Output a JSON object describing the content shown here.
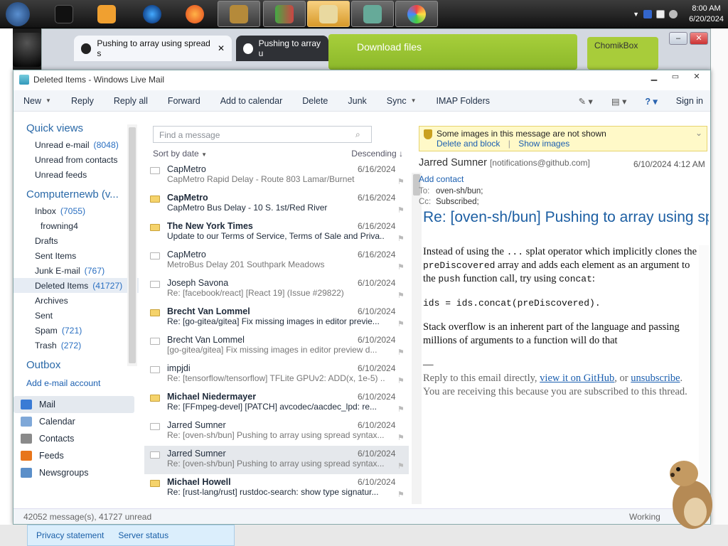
{
  "taskbar": {
    "time": "8:00 AM",
    "date": "6/20/2024"
  },
  "browser": {
    "tab1_title": "Pushing to array using spread s",
    "tab1_close": "✕",
    "tab2_title": "Pushing to array u",
    "banner_text": "Download files",
    "chomik_label": "ChomikBox"
  },
  "window": {
    "title": "Deleted Items - Windows Live Mail"
  },
  "toolbar": {
    "new": "New",
    "reply": "Reply",
    "reply_all": "Reply all",
    "forward": "Forward",
    "add_calendar": "Add to calendar",
    "delete": "Delete",
    "junk": "Junk",
    "sync": "Sync",
    "imap": "IMAP Folders",
    "sign_in": "Sign in"
  },
  "nav": {
    "quick_views": "Quick views",
    "quick": [
      {
        "label": "Unread e-mail",
        "count": "(8048)"
      },
      {
        "label": "Unread from contacts",
        "count": ""
      },
      {
        "label": "Unread feeds",
        "count": ""
      }
    ],
    "account": "Computernewb (v...",
    "folders": [
      {
        "label": "Inbox",
        "count": "(7055)"
      },
      {
        "label": "frowning4",
        "count": ""
      },
      {
        "label": "Drafts",
        "count": ""
      },
      {
        "label": "Sent Items",
        "count": ""
      },
      {
        "label": "Junk E-mail",
        "count": "(767)"
      },
      {
        "label": "Deleted Items",
        "count": "(41727)"
      },
      {
        "label": "Archives",
        "count": ""
      },
      {
        "label": "Sent",
        "count": ""
      },
      {
        "label": "Spam",
        "count": "(721)"
      },
      {
        "label": "Trash",
        "count": "(272)"
      }
    ],
    "outbox": "Outbox",
    "add_account": "Add e-mail account",
    "modules": [
      "Mail",
      "Calendar",
      "Contacts",
      "Feeds",
      "Newsgroups"
    ]
  },
  "list": {
    "search_placeholder": "Find a message",
    "sort_label": "Sort by date",
    "order_label": "Descending",
    "messages": [
      {
        "from": "CapMetro",
        "date": "6/16/2024",
        "subject": "CapMetro Rapid Delay - Route 803 Lamar/Burnet"
      },
      {
        "from": "CapMetro",
        "date": "6/16/2024",
        "subject": "CapMetro Bus Delay - 10 S. 1st/Red River"
      },
      {
        "from": "The New York Times",
        "date": "6/16/2024",
        "subject": "Update to our Terms of Service, Terms of Sale and Priva..."
      },
      {
        "from": "CapMetro",
        "date": "6/16/2024",
        "subject": "MetroBus Delay 201 Southpark Meadows"
      },
      {
        "from": "Joseph Savona",
        "date": "6/10/2024",
        "subject": "Re: [facebook/react] [React 19] (Issue #29822)"
      },
      {
        "from": "Brecht Van Lommel",
        "date": "6/10/2024",
        "subject": "Re: [go-gitea/gitea] Fix missing images in editor previe..."
      },
      {
        "from": "Brecht Van Lommel",
        "date": "6/10/2024",
        "subject": "[go-gitea/gitea] Fix missing images in editor preview d..."
      },
      {
        "from": "impjdi",
        "date": "6/10/2024",
        "subject": "Re: [tensorflow/tensorflow] TFLite GPUv2: ADD(x, 1e-5) ..."
      },
      {
        "from": "Michael Niedermayer",
        "date": "6/10/2024",
        "subject": "Re: [FFmpeg-devel] [PATCH] avcodec/aacdec_lpd: re..."
      },
      {
        "from": "Jarred Sumner",
        "date": "6/10/2024",
        "subject": "Re: [oven-sh/bun] Pushing to array using spread syntax..."
      },
      {
        "from": "Jarred Sumner",
        "date": "6/10/2024",
        "subject": "Re: [oven-sh/bun] Pushing to array using spread syntax..."
      },
      {
        "from": "Michael Howell",
        "date": "6/10/2024",
        "subject": "Re: [rust-lang/rust] rustdoc-search: show type signatur..."
      }
    ]
  },
  "reading": {
    "warn_text": "Some images in this message are not shown",
    "delete_block": "Delete and block",
    "separator": "|",
    "show_images": "Show images",
    "from_name": "Jarred Sumner",
    "from_email": "[notifications@github.com]",
    "date": "6/10/2024 4:12 AM",
    "add_contact": "Add contact",
    "to_label": "To:",
    "to_value": "oven-sh/bun;",
    "cc_label": "Cc:",
    "cc_value": "Subscribed;",
    "subject": "Re: [oven-sh/bun] Pushing to array using spread syntax",
    "p1_a": "Instead of using the ",
    "p1_code1": "...",
    "p1_b": " splat operator which implicitly clones the ",
    "p1_code2": "preDiscovered",
    "p1_c": " array and adds each element as an argument to the ",
    "p1_code3": "push",
    "p1_d": " function call, try using ",
    "p1_code4": "concat",
    "p1_e": ":",
    "code_line": "ids = ids.concat(preDiscovered).",
    "p2": "Stack overflow is an inherent part of the language and passing millions of arguments to a function will do that",
    "dash": "—",
    "foot_a": "Reply to this email directly, ",
    "foot_link1": "view it on GitHub",
    "foot_b": ", or ",
    "foot_link2": "unsubscribe",
    "foot_c": ". You are receiving this because you are subscribed to this thread."
  },
  "status": {
    "count": "42052 message(s), 41727 unread",
    "working": "Working"
  },
  "bottom": {
    "privacy": "Privacy statement",
    "server": "Server status"
  }
}
